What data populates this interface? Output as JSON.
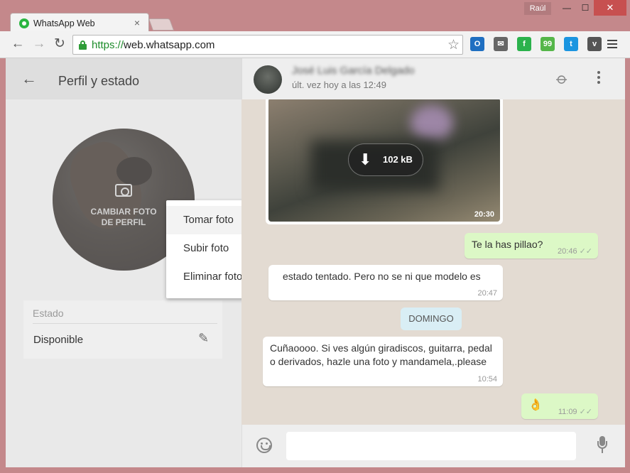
{
  "browser": {
    "tab_title": "WhatsApp Web",
    "tab_close": "×",
    "user_badge": "Raúl",
    "minimize": "—",
    "maximize": "☐",
    "close": "✕",
    "url_protocol": "https://",
    "url_host": "web.whatsapp.com",
    "extensions": [
      {
        "name": "outlook",
        "color": "#1f6fc1",
        "glyph": "O"
      },
      {
        "name": "mail",
        "color": "#666666",
        "glyph": "✉"
      },
      {
        "name": "feedly",
        "color": "#2bb24c",
        "glyph": "f"
      },
      {
        "name": "evernote",
        "color": "#55b649",
        "glyph": "99"
      },
      {
        "name": "twitter",
        "color": "#1b95e0",
        "glyph": "t"
      },
      {
        "name": "pocket",
        "color": "#555555",
        "glyph": "v"
      }
    ]
  },
  "profile": {
    "title": "Perfil y estado",
    "change_photo": "CAMBIAR FOTO\nDE PERFIL",
    "status_label": "Estado",
    "status_value": "Disponible"
  },
  "context_menu": {
    "items": [
      "Tomar foto",
      "Subir foto",
      "Eliminar foto"
    ],
    "active_index": 0
  },
  "chat": {
    "contact_name": "José Luis García Delgado",
    "contact_status": "últ. vez hoy a las 12:49",
    "image_size": "102 kB",
    "image_time": "20:30",
    "messages": [
      {
        "text": "Te la has pillao?",
        "time": "20:46",
        "direction": "out"
      },
      {
        "text": "estado tentado. Pero no se ni que modelo es",
        "time": "20:47",
        "direction": "in"
      },
      {
        "text": "Cuñaoooo. Si ves algún giradiscos, guitarra, pedal",
        "text2": "o derivados, hazle una foto y mandamela,.please",
        "time": "10:54",
        "direction": "in"
      },
      {
        "text": "👌",
        "time": "11:09",
        "direction": "out"
      }
    ],
    "day_separator": "DOMINGO",
    "input_value": ""
  },
  "colors": {
    "outgoing_bubble": "#dcf8c6",
    "incoming_bubble": "#ffffff",
    "chat_background": "#e3dbd2",
    "brand_green": "#2ab540"
  }
}
